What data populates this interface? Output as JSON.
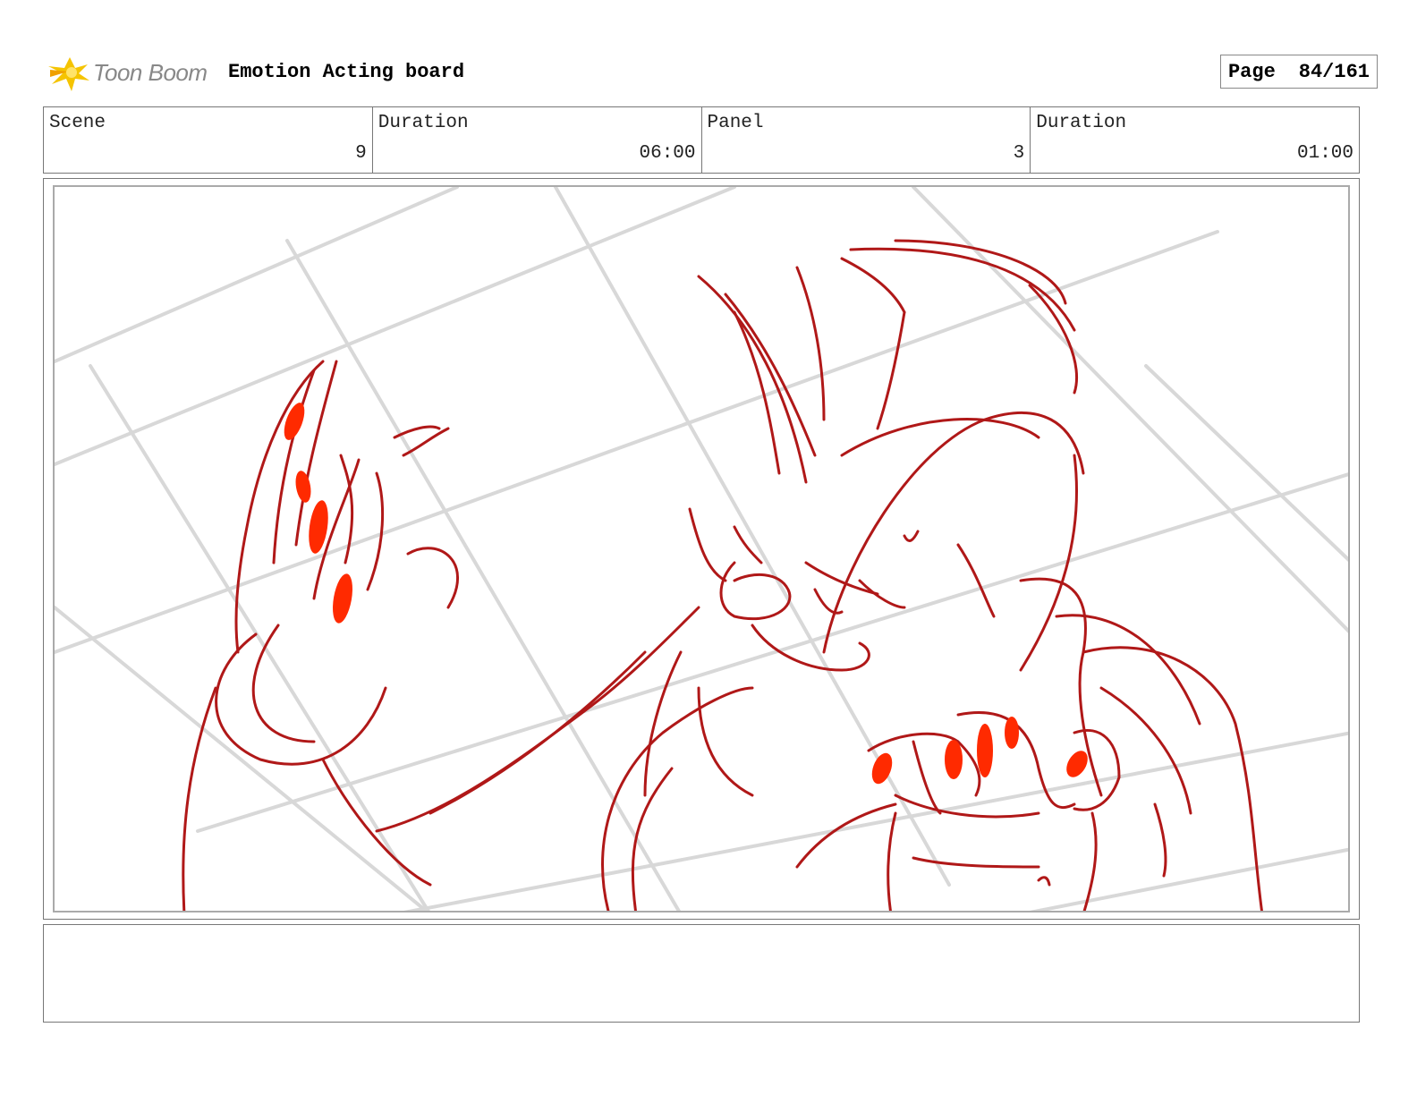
{
  "header": {
    "logo_text": "Toon Boom",
    "board_title": "Emotion Acting board",
    "page_label": "Page",
    "page_value": "84/161"
  },
  "info": [
    {
      "label": "Scene",
      "value": "9"
    },
    {
      "label": "Duration",
      "value": "06:00"
    },
    {
      "label": "Panel",
      "value": "3"
    },
    {
      "label": "Duration",
      "value": "01:00"
    }
  ],
  "notes": {
    "text": ""
  },
  "colors": {
    "sketch_line": "#b01818",
    "sketch_fill": "#ff2a00",
    "guide_line": "#d8d8d8",
    "logo_accent": "#f5c400"
  },
  "icons": {
    "logo": "toon-boom-starburst-icon"
  }
}
